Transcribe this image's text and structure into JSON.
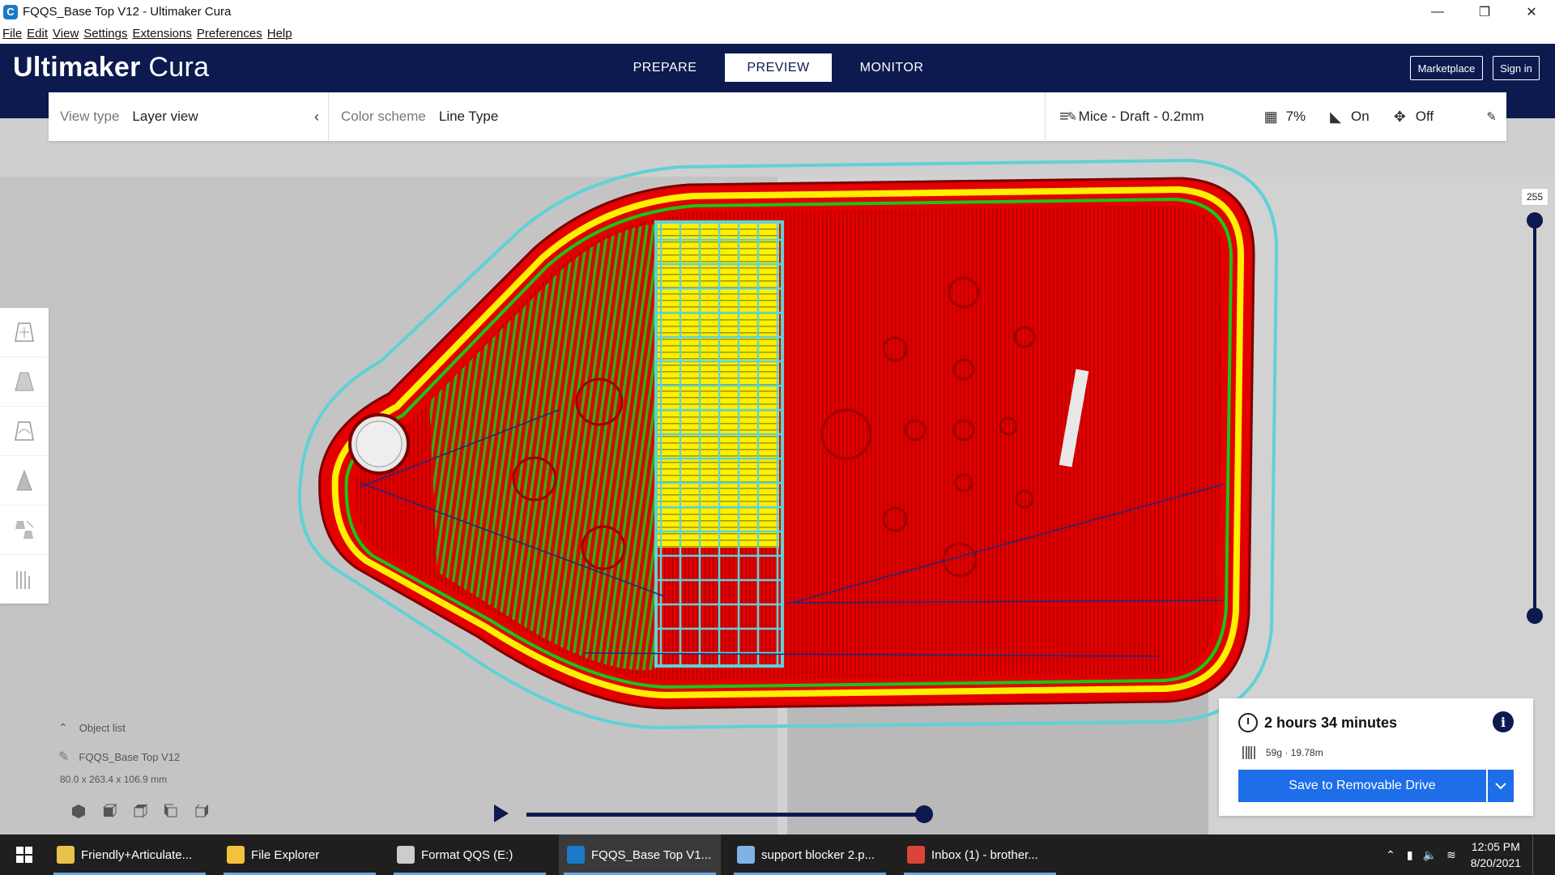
{
  "window": {
    "title": "FQQS_Base Top V12 - Ultimaker Cura",
    "icon": "cura-icon",
    "controls": [
      "—",
      "❐",
      "✕"
    ]
  },
  "menu": [
    "File",
    "Edit",
    "View",
    "Settings",
    "Extensions",
    "Preferences",
    "Help"
  ],
  "header": {
    "logo_bold": "Ultimaker",
    "logo_light": " Cura",
    "tabs": [
      {
        "label": "PREPARE",
        "active": false
      },
      {
        "label": "PREVIEW",
        "active": true
      },
      {
        "label": "MONITOR",
        "active": false
      }
    ],
    "marketplace": "Marketplace",
    "signin": "Sign in"
  },
  "toolbar": {
    "view_type_label": "View type",
    "view_type_value": "Layer view",
    "color_scheme_label": "Color scheme",
    "color_scheme_value": "Line Type",
    "profile": "Mice - Draft - 0.2mm",
    "infill": "7%",
    "support": "On",
    "adhesion": "Off"
  },
  "layer_slider": {
    "max_layer": "255",
    "top_value": 1.0,
    "bottom_value": 0.0
  },
  "object_list": {
    "label": "Object list",
    "object_name": "FQQS_Base Top V12",
    "dimensions": "80.0 x 263.4 x 106.9 mm"
  },
  "playback": {
    "progress": 1.0
  },
  "print_info": {
    "time": "2 hours 34 minutes",
    "material": "59g · 19.78m",
    "save_button": "Save to Removable Drive"
  },
  "taskbar": {
    "items": [
      {
        "label": "Friendly+Articulate...",
        "icon": "folder-zip-icon",
        "color": "#e8c24a",
        "active": false
      },
      {
        "label": "File Explorer",
        "icon": "folder-icon",
        "color": "#f3c13a",
        "active": false
      },
      {
        "label": "Format QQS (E:)",
        "icon": "drive-icon",
        "color": "#cccccc",
        "active": false
      },
      {
        "label": "FQQS_Base Top V1...",
        "icon": "cura-icon",
        "color": "#1a7ac7",
        "active": true
      },
      {
        "label": "support blocker 2.p...",
        "icon": "paint-icon",
        "color": "#7fb3e6",
        "active": false
      },
      {
        "label": "Inbox (1) - brother...",
        "icon": "chrome-icon",
        "color": "#db4437",
        "active": false
      }
    ],
    "time": "12:05 PM",
    "date": "8/20/2021"
  },
  "colors": {
    "header_bg": "#0d1a4f",
    "accent": "#1d6ee8",
    "wall_red": "#e30000",
    "infill_yellow": "#ffef00",
    "skin_green": "#19c619",
    "support_cyan": "#5fd2d6"
  }
}
